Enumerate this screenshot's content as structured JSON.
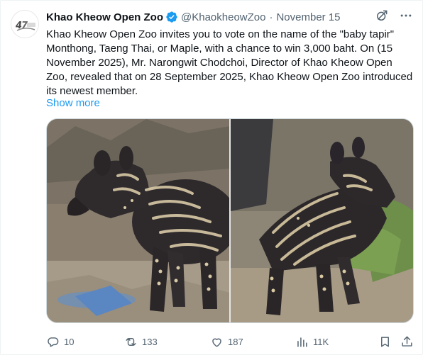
{
  "author": {
    "name": "Khao Kheow Open Zoo",
    "handle": "@KhaokheowZoo",
    "separator": "·",
    "date": "November 15",
    "verified": true
  },
  "post": {
    "text": "Khao Kheow Open Zoo invites you to vote on the name of the \"baby tapir\" Monthong, Taeng Thai, or Maple, with a chance to win 3,000 baht. On (15 November 2025), Mr. Narongwit Chodchoi, Director of Khao Kheow Open Zoo, revealed that on 28 September 2025, Khao Kheow Open Zoo introduced its newest member.",
    "show_more": "Show more"
  },
  "media": {
    "photos": [
      "baby-tapir-photo-1",
      "baby-tapir-photo-2"
    ]
  },
  "actions": {
    "replies": "10",
    "reposts": "133",
    "likes": "187",
    "views": "11K"
  },
  "icons": [
    "grok-icon",
    "more-icon",
    "verified-badge-icon",
    "reply-icon",
    "repost-icon",
    "like-icon",
    "views-icon",
    "bookmark-icon",
    "share-icon"
  ],
  "colors": {
    "accent": "#1d9bf0",
    "text": "#0f1419",
    "muted": "#536471"
  }
}
